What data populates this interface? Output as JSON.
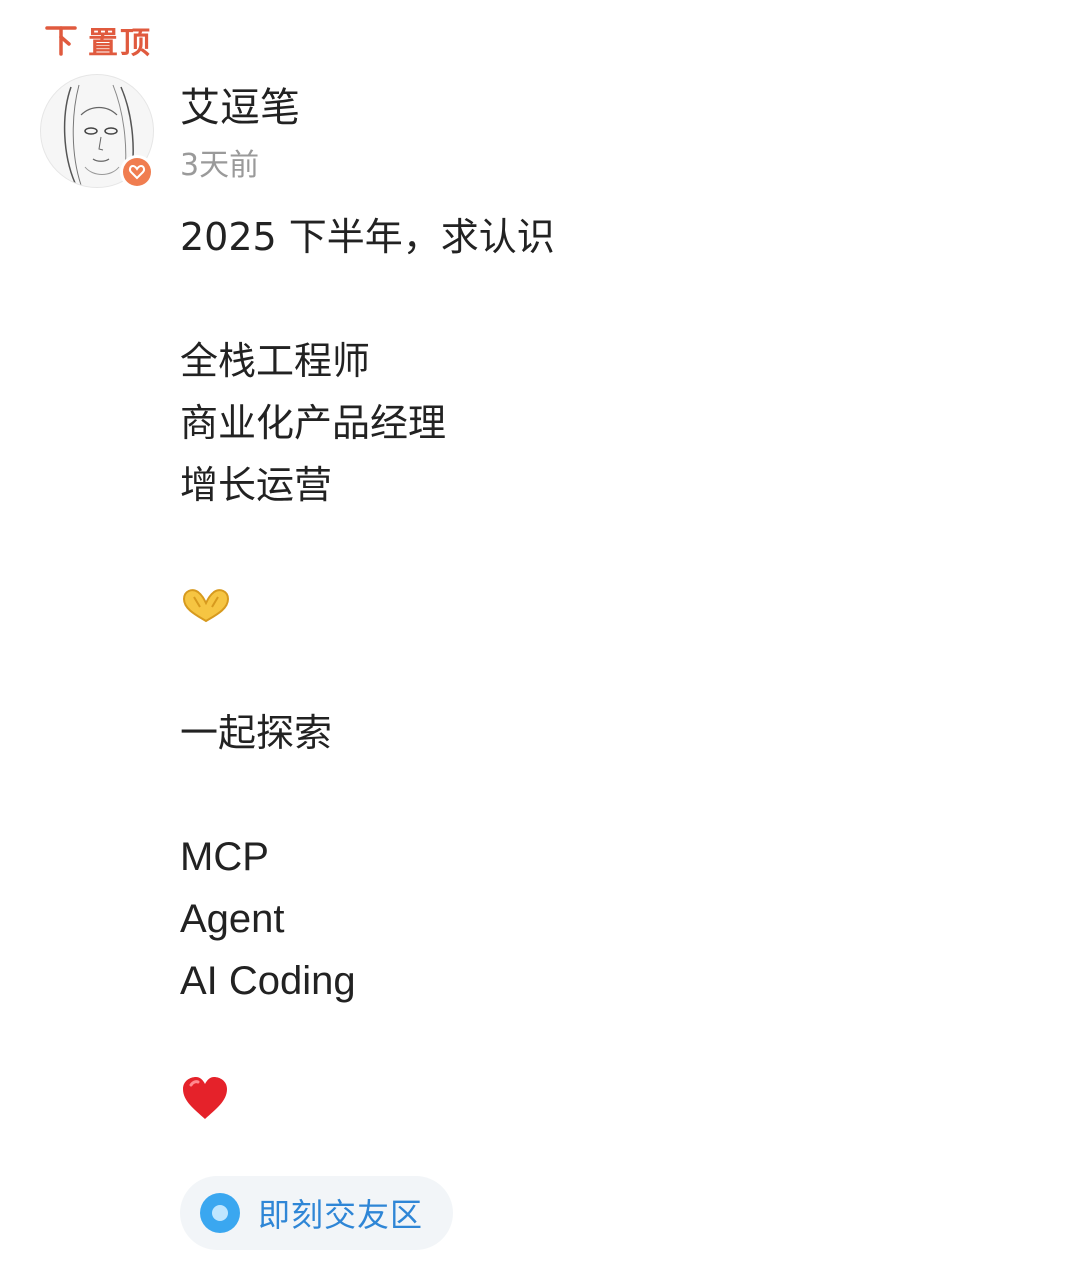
{
  "pin": {
    "label": "置顶",
    "icon": "pin-top-icon",
    "color": "#e05a3e"
  },
  "author": {
    "name": "艾逗笔",
    "time": "3天前",
    "badge_icon": "heart-badge-icon"
  },
  "post": {
    "lines": [
      "2025 下半年，求认识",
      "",
      "全栈工程师",
      "商业化产品经理",
      "增长运营",
      "",
      "🫶",
      "",
      "一起探索",
      "",
      "MCP",
      "Agent",
      "AI Coding",
      "",
      "❤️"
    ]
  },
  "topic": {
    "label": "即刻交友区",
    "icon": "topic-circle-icon",
    "color": "#3aa7f0"
  }
}
